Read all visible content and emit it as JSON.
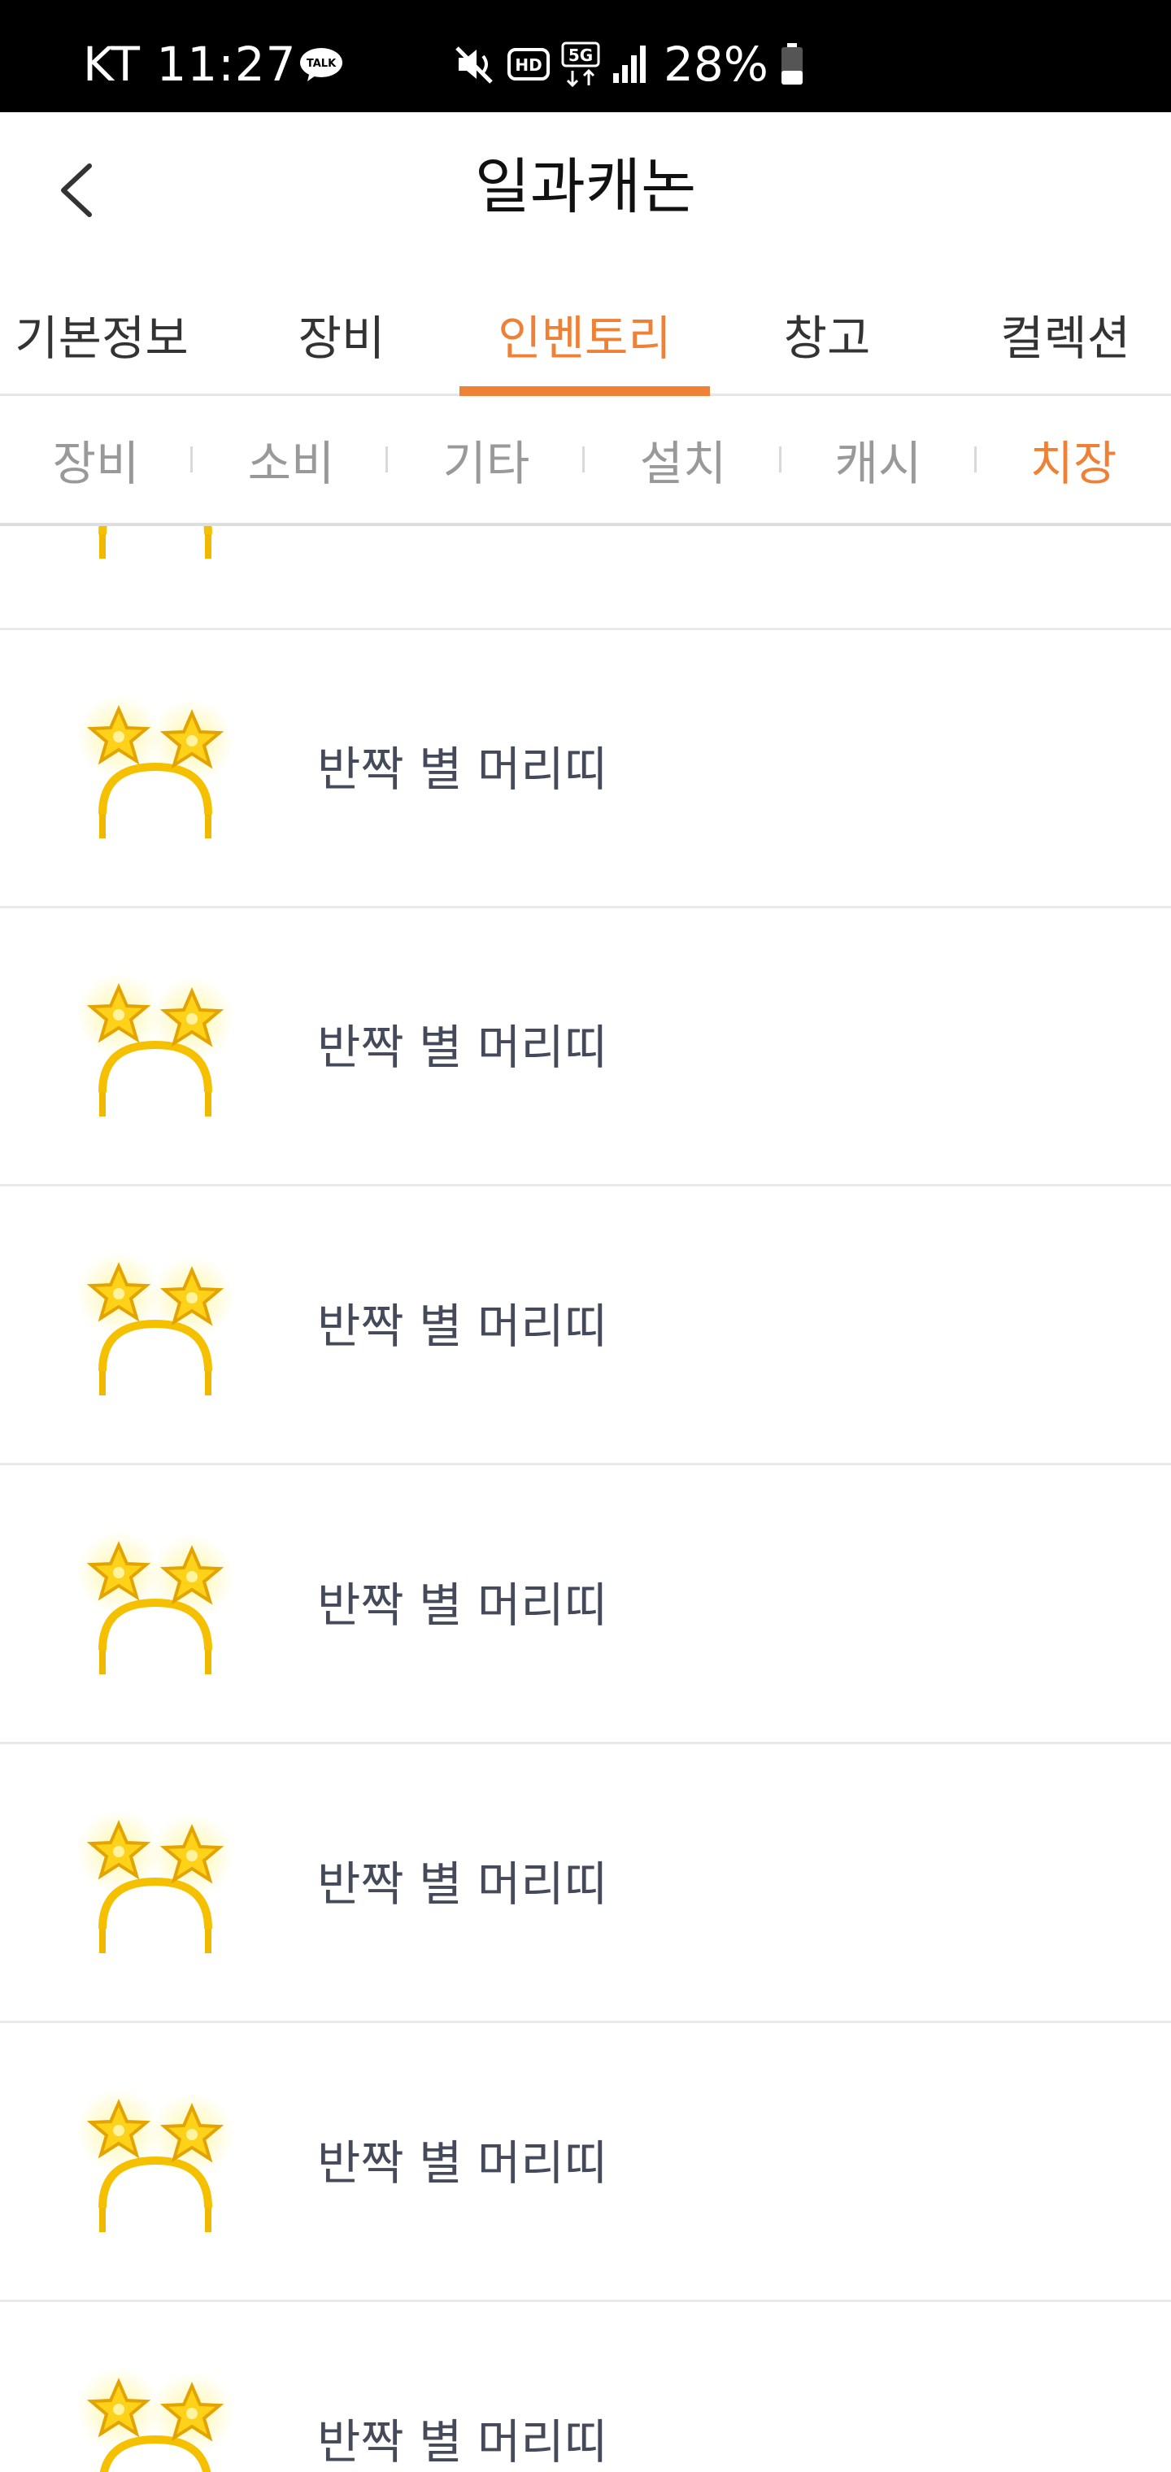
{
  "status_bar": {
    "carrier_time": "KT 11:27",
    "talk_label": "TALK",
    "network": "5G",
    "hd_label": "HD",
    "battery": "28%",
    "icons": [
      "talk-icon",
      "mute-icon",
      "hd-icon",
      "5g-icon",
      "signal-icon",
      "battery-icon"
    ]
  },
  "header": {
    "title": "일과캐논",
    "back_icon": "chevron-left-icon"
  },
  "main_tabs": [
    {
      "label": "기본정보",
      "active": false
    },
    {
      "label": "장비",
      "active": false
    },
    {
      "label": "인벤토리",
      "active": true
    },
    {
      "label": "창고",
      "active": false
    },
    {
      "label": "컬렉션",
      "active": false
    }
  ],
  "sub_tabs": [
    {
      "label": "장비",
      "active": false
    },
    {
      "label": "소비",
      "active": false
    },
    {
      "label": "기타",
      "active": false
    },
    {
      "label": "설치",
      "active": false
    },
    {
      "label": "캐시",
      "active": false
    },
    {
      "label": "치장",
      "active": true
    }
  ],
  "items": [
    {
      "name": "",
      "icon": "star-headband-icon"
    },
    {
      "name": "반짝 별 머리띠",
      "icon": "star-headband-icon"
    },
    {
      "name": "반짝 별 머리띠",
      "icon": "star-headband-icon"
    },
    {
      "name": "반짝 별 머리띠",
      "icon": "star-headband-icon"
    },
    {
      "name": "반짝 별 머리띠",
      "icon": "star-headband-icon"
    },
    {
      "name": "반짝 별 머리띠",
      "icon": "star-headband-icon"
    },
    {
      "name": "반짝 별 머리띠",
      "icon": "star-headband-icon"
    },
    {
      "name": "반짝 별 머리띠",
      "icon": "star-headband-icon"
    }
  ],
  "colors": {
    "accent": "#ee8136",
    "status_bar_bg": "#000000",
    "item_text": "#444a5a",
    "inactive_sub_tab": "#999999"
  }
}
